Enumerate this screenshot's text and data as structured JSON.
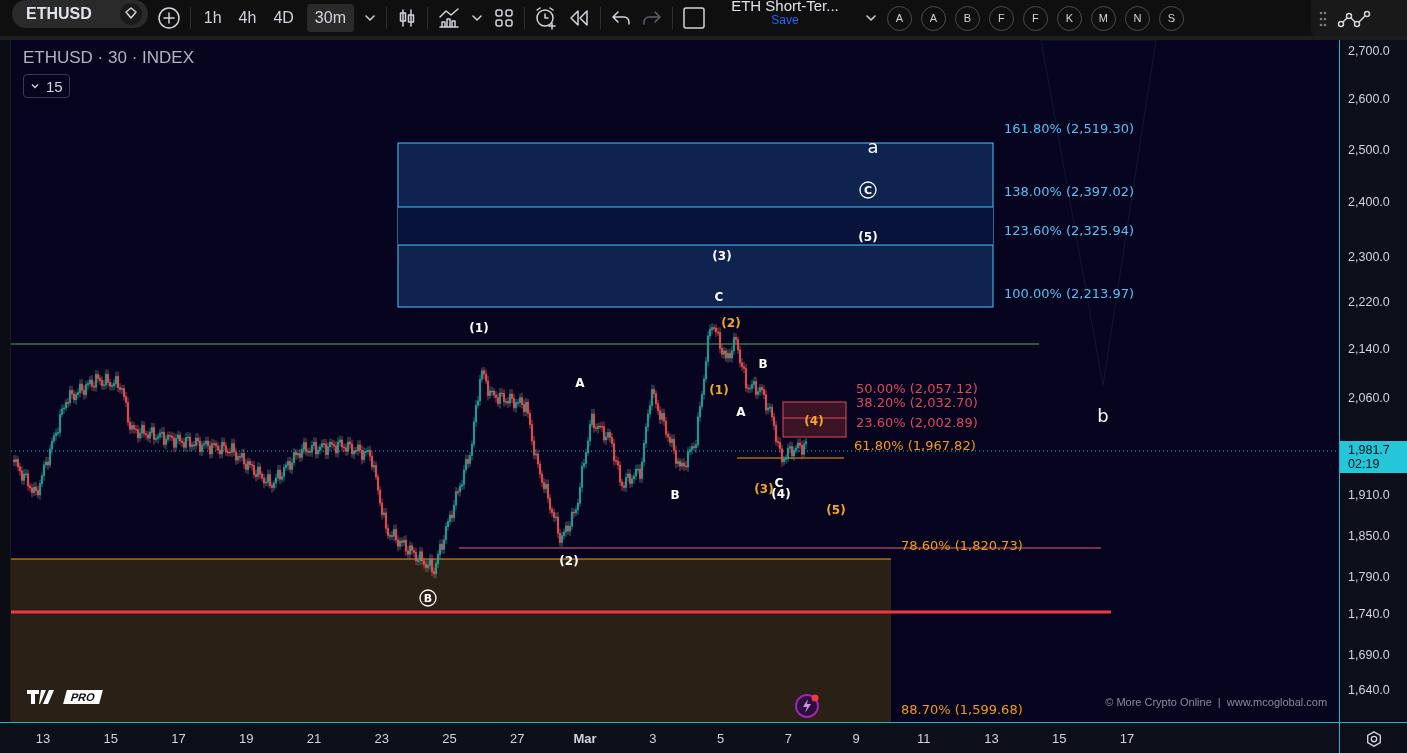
{
  "toolbar": {
    "symbol": "ETHUSD",
    "intervals": [
      {
        "label": "1h",
        "selected": false
      },
      {
        "label": "4h",
        "selected": false
      },
      {
        "label": "4D",
        "selected": false
      },
      {
        "label": "30m",
        "selected": true
      }
    ],
    "layout": {
      "name": "ETH Short-Ter...",
      "action": "Save"
    },
    "drawing_shortcuts": [
      "A",
      "A",
      "B",
      "F",
      "F",
      "K",
      "M",
      "N",
      "S"
    ]
  },
  "legend": {
    "title": "ETHUSD · 30 · INDEX",
    "collapse_count": "15"
  },
  "wave_labels": [
    {
      "text": "a",
      "color": "#ffffff",
      "kind": "large"
    },
    {
      "text": "C",
      "color": "#ffffff",
      "kind": "circled"
    },
    {
      "text": "(5)",
      "color": "#ffffff",
      "kind": "plain"
    },
    {
      "text": "(3)",
      "color": "#ffffff",
      "kind": "plain"
    },
    {
      "text": "C",
      "color": "#ffffff",
      "kind": "plain"
    },
    {
      "text": "(1)",
      "color": "#ffffff",
      "kind": "plain"
    },
    {
      "text": "(2)",
      "color": "#f5a623",
      "kind": "plain"
    },
    {
      "text": "B",
      "color": "#ffffff",
      "kind": "plain"
    },
    {
      "text": "A",
      "color": "#ffffff",
      "kind": "plain"
    },
    {
      "text": "(1)",
      "color": "#f5a623",
      "kind": "plain"
    },
    {
      "text": "A",
      "color": "#ffffff",
      "kind": "plain"
    },
    {
      "text": "(4)",
      "color": "#f5a623",
      "kind": "plain"
    },
    {
      "text": "B",
      "color": "#ffffff",
      "kind": "plain"
    },
    {
      "text": "(3)",
      "color": "#f5a623",
      "kind": "plain"
    },
    {
      "text": "C",
      "color": "#ffffff",
      "kind": "plain"
    },
    {
      "text": "(4)",
      "color": "#ffffff",
      "kind": "plain"
    },
    {
      "text": "(5)",
      "color": "#f5a623",
      "kind": "plain"
    },
    {
      "text": "(2)",
      "color": "#ffffff",
      "kind": "plain"
    },
    {
      "text": "B",
      "color": "#ffffff",
      "kind": "circled"
    },
    {
      "text": "b",
      "color": "#ffffff",
      "kind": "large"
    }
  ],
  "fib_levels": [
    {
      "label": "161.80% (2,519.30)",
      "color": "#4fc3f7"
    },
    {
      "label": "138.00% (2,397.02)",
      "color": "#4fc3f7"
    },
    {
      "label": "123.60% (2,325.94)",
      "color": "#4fc3f7"
    },
    {
      "label": "100.00% (2,213.97)",
      "color": "#4fc3f7"
    },
    {
      "label": "50.00% (2,057.12)",
      "color": "#e2475a"
    },
    {
      "label": "38.20% (2,032.70)",
      "color": "#e2475a"
    },
    {
      "label": "23.60% (2,002.89)",
      "color": "#e2475a"
    },
    {
      "label": "61.80% (1,967.82)",
      "color": "#f59d0b"
    },
    {
      "label": "78.60% (1,820.73)",
      "color": "#f59d0b"
    },
    {
      "label": "88.70% (1,599.68)",
      "color": "#f59d0b"
    }
  ],
  "credit": "© More Crypto Online  |  www.mcoglobal.com",
  "logo": {
    "badge": "PRO"
  },
  "price_axis": {
    "labels": [
      "2,700.0",
      "2,600.0",
      "2,500.0",
      "2,400.0",
      "2,300.0",
      "2,220.0",
      "2,140.0",
      "2,060.0",
      "1,910.0",
      "1,850.0",
      "1,790.0",
      "1,740.0",
      "1,690.0",
      "1,640.0"
    ],
    "current": {
      "price": "1,981.7",
      "countdown": "02:19"
    }
  },
  "time_axis": [
    "13",
    "15",
    "17",
    "19",
    "21",
    "23",
    "25",
    "27",
    "Mar",
    "3",
    "5",
    "7",
    "9",
    "11",
    "13",
    "15",
    "17"
  ]
}
